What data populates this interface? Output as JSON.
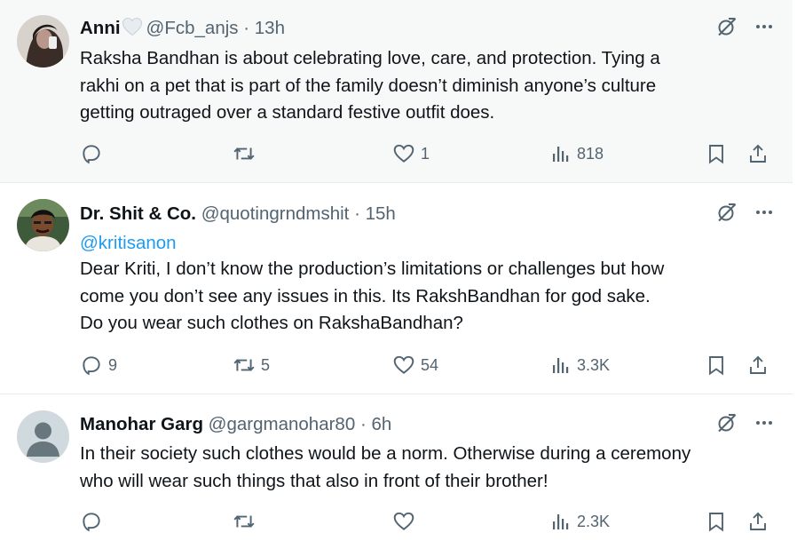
{
  "tweets": [
    {
      "display_name": "Anni",
      "handle": "@Fcb_anjs",
      "time": "13h",
      "mention": "",
      "lines": [
        "Raksha Bandhan is about celebrating love, care, and protection. Tying a",
        "rakhi on a pet that is part of the family doesn’t diminish anyone’s culture",
        "getting outraged over a standard festive outfit does."
      ],
      "replies": "",
      "reposts": "",
      "likes": "1",
      "views": "818"
    },
    {
      "display_name": "Dr. Shit & Co.",
      "handle": "@quotingrndmshit",
      "time": "15h",
      "mention": "@kritisanon",
      "lines": [
        "Dear Kriti, I don’t know the production’s limitations or challenges but how",
        "come you don’t see any issues in this. Its RakshBandhan for god sake.",
        "Do you wear such clothes on RakshaBandhan?"
      ],
      "replies": "9",
      "reposts": "5",
      "likes": "54",
      "views": "3.3K"
    },
    {
      "display_name": "Manohar Garg",
      "handle": "@gargmanohar80",
      "time": "6h",
      "mention": "",
      "lines": [
        "In their society such clothes would be a norm. Otherwise during a ceremony",
        "who will wear such things that also in front of their brother!"
      ],
      "replies": "",
      "reposts": "",
      "likes": "",
      "views": "2.3K"
    }
  ],
  "icons": {
    "reply": "reply-icon",
    "repost": "repost-icon",
    "like": "heart-icon",
    "views": "views-icon",
    "bookmark": "bookmark-icon",
    "share": "share-icon",
    "grok": "grok-icon",
    "more": "more-icon",
    "heart_emoji": "white-heart-emoji-icon"
  },
  "colors": {
    "text": "#0f1419",
    "secondary": "#536471",
    "link": "#1d9bf0",
    "hover_bg": "#f7f8f8"
  },
  "separator": "·"
}
